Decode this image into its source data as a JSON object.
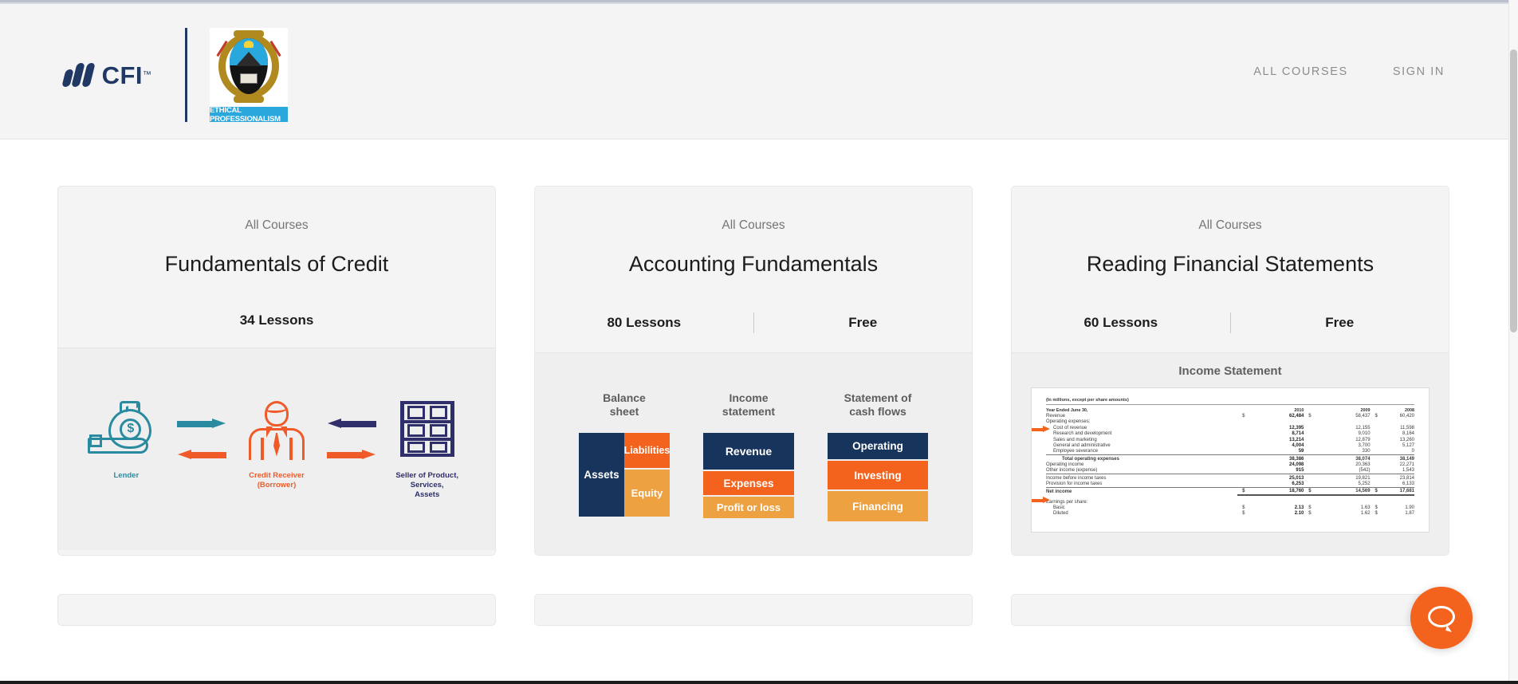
{
  "header": {
    "brand_name": "CFI",
    "brand_tm": "™",
    "partner_tagline": "ETHICAL PROFESSIONALISM",
    "nav": [
      {
        "label": "ALL COURSES"
      },
      {
        "label": "SIGN IN"
      }
    ]
  },
  "courses": [
    {
      "eyebrow": "All Courses",
      "title": "Fundamentals of Credit",
      "lessons": "34 Lessons",
      "price": "",
      "art": "credit-flow",
      "art_labels": {
        "lender": "Lender",
        "borrower_line1": "Credit Receiver",
        "borrower_line2": "(Borrower)",
        "seller_line1": "Seller of Product,",
        "seller_line2": "Services,",
        "seller_line3": "Assets"
      }
    },
    {
      "eyebrow": "All Courses",
      "title": "Accounting Fundamentals",
      "lessons": "80 Lessons",
      "price": "Free",
      "art": "fs-diagram",
      "diagram": {
        "columns": [
          {
            "heading_line1": "Balance",
            "heading_line2": "sheet",
            "blocks": [
              "Assets",
              "Liabilities",
              "Equity"
            ]
          },
          {
            "heading_line1": "Income",
            "heading_line2": "statement",
            "blocks": [
              "Revenue",
              "Expenses",
              "Profit or loss"
            ]
          },
          {
            "heading_line1": "Statement of",
            "heading_line2": "cash flows",
            "blocks": [
              "Operating",
              "Investing",
              "Financing"
            ]
          }
        ]
      }
    },
    {
      "eyebrow": "All Courses",
      "title": "Reading Financial Statements",
      "lessons": "60 Lessons",
      "price": "Free",
      "art": "income-statement",
      "art_title": "Income Statement"
    }
  ],
  "income_statement": {
    "note": "(In millions, except per share amounts)",
    "period_label": "Year Ended June 30,",
    "years": [
      "2010",
      "2009",
      "2008"
    ],
    "rows": [
      {
        "label": "Revenue",
        "values": [
          "62,484",
          "58,437",
          "60,420"
        ],
        "currency": true
      },
      {
        "label": "Operating expenses:",
        "values": [
          "",
          "",
          ""
        ]
      },
      {
        "label": "Cost of revenue",
        "values": [
          "12,395",
          "12,155",
          "11,598"
        ],
        "indent": 1
      },
      {
        "label": "Research and development",
        "values": [
          "8,714",
          "9,010",
          "8,164"
        ],
        "indent": 1
      },
      {
        "label": "Sales and marketing",
        "values": [
          "13,214",
          "12,879",
          "13,260"
        ],
        "indent": 1
      },
      {
        "label": "General and administrative",
        "values": [
          "4,004",
          "3,700",
          "5,127"
        ],
        "indent": 1
      },
      {
        "label": "Employee severance",
        "values": [
          "59",
          "330",
          "0"
        ],
        "indent": 1
      },
      {
        "label": "Total operating expenses",
        "values": [
          "38,386",
          "38,074",
          "38,149"
        ],
        "indent": 2,
        "topline": true
      },
      {
        "label": "Operating income",
        "values": [
          "24,098",
          "20,363",
          "22,271"
        ]
      },
      {
        "label": "Other income (expense)",
        "values": [
          "915",
          "(542)",
          "1,543"
        ]
      },
      {
        "label": "Income before income taxes",
        "values": [
          "25,013",
          "19,821",
          "23,814"
        ],
        "topline": true
      },
      {
        "label": "Provision for income taxes",
        "values": [
          "6,253",
          "5,252",
          "6,133"
        ]
      },
      {
        "label": "Net income",
        "values": [
          "18,760",
          "14,569",
          "17,681"
        ],
        "currency": true,
        "topline": true,
        "double": true
      },
      {
        "label": "Earnings per share:",
        "values": [
          "",
          "",
          ""
        ],
        "gap_before": true
      },
      {
        "label": "Basic",
        "values": [
          "2.13",
          "1.63",
          "1.90"
        ],
        "indent": 1,
        "currency": true
      },
      {
        "label": "Diluted",
        "values": [
          "2.10",
          "1.62",
          "1.87"
        ],
        "indent": 1,
        "currency": true
      }
    ]
  },
  "chat": {
    "icon": "chat-bubble-icon"
  },
  "colors": {
    "navy": "#17355c",
    "orange": "#f4631e",
    "amber": "#eda141",
    "teal": "#2a8ba0",
    "deep_navy": "#2e2f6b",
    "brand_navy": "#1f3864",
    "page_bg": "#ffffff",
    "card_bg": "#f4f4f4"
  }
}
